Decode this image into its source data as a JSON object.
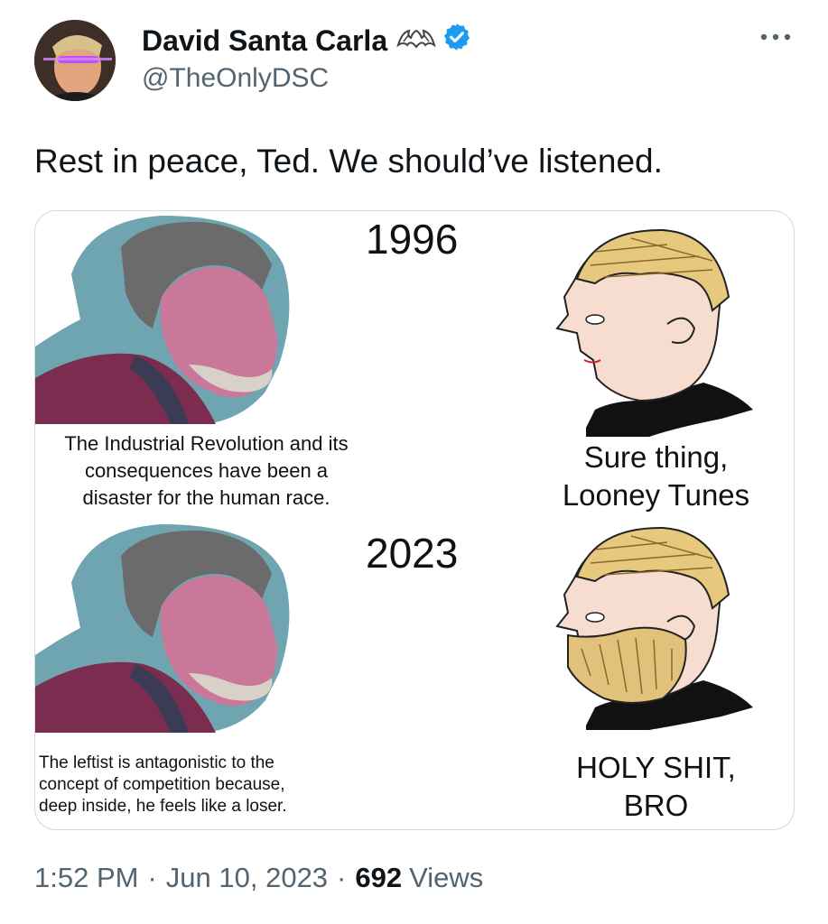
{
  "author": {
    "name": "David Santa Carla",
    "handle": "@TheOnlyDSC",
    "verified_color": "#1d9bf0"
  },
  "tweet": {
    "text": "Rest in peace, Ted. We should’ve listened."
  },
  "meme": {
    "panels": [
      {
        "year": "1996",
        "left_caption": "The Industrial Revolution and its\nconsequences have been a\ndisaster for the human race.",
        "right_caption": "Sure thing,\nLooney Tunes"
      },
      {
        "year": "2023",
        "left_caption": "The leftist is antagonistic to the\nconcept of competition because,\ndeep inside, he feels like a loser.",
        "right_caption": "HOLY SHIT,\nBRO"
      }
    ]
  },
  "meta": {
    "time": "1:52 PM",
    "separator": "·",
    "date": "Jun 10, 2023",
    "views_count": "692",
    "views_label": "Views"
  },
  "icons": {
    "more": "more-horizontal-icon",
    "bat": "bat-emoji-icon",
    "verified": "verified-badge-icon"
  }
}
